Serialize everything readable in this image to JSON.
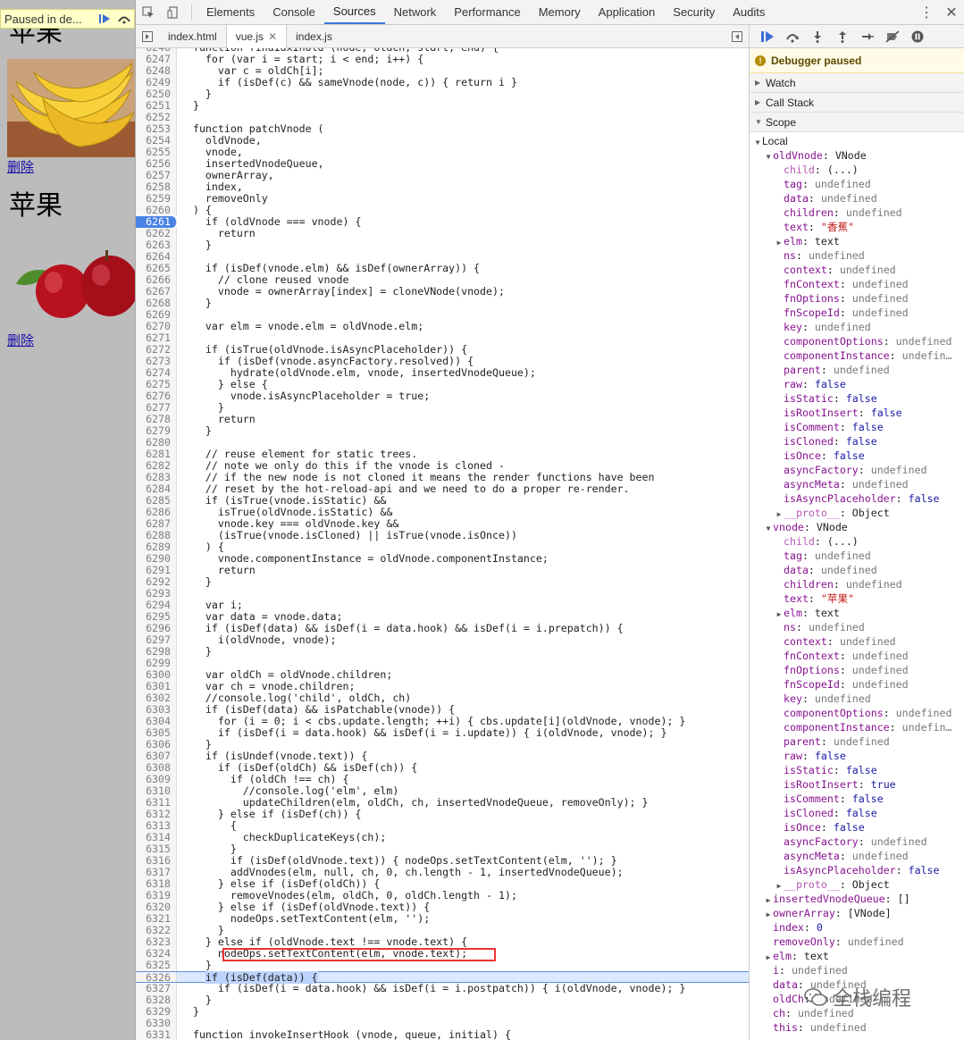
{
  "preview": {
    "paused_text": "Paused in de...",
    "items": [
      {
        "title": "苹果",
        "delete": "删除"
      },
      {
        "title": "苹果",
        "delete": "删除"
      }
    ]
  },
  "devtools": {
    "tabs": [
      "Elements",
      "Console",
      "Sources",
      "Network",
      "Performance",
      "Memory",
      "Application",
      "Security",
      "Audits"
    ],
    "active_tab": "Sources",
    "file_tabs": [
      {
        "name": "index.html",
        "active": false,
        "closable": false
      },
      {
        "name": "vue.js",
        "active": true,
        "closable": true
      },
      {
        "name": "index.js",
        "active": false,
        "closable": false
      }
    ],
    "breakpoint_line": 6261,
    "paused_line": 6326,
    "highlighted_line": 6324,
    "code_lines": [
      {
        "n": 6246,
        "t": "  function findIdxInOld (node, oldCh, start, end) {"
      },
      {
        "n": 6247,
        "t": "    for (var i = start; i < end; i++) {"
      },
      {
        "n": 6248,
        "t": "      var c = oldCh[i];"
      },
      {
        "n": 6249,
        "t": "      if (isDef(c) && sameVnode(node, c)) { return i }"
      },
      {
        "n": 6250,
        "t": "    }"
      },
      {
        "n": 6251,
        "t": "  }"
      },
      {
        "n": 6252,
        "t": ""
      },
      {
        "n": 6253,
        "t": "  function patchVnode ("
      },
      {
        "n": 6254,
        "t": "    oldVnode,"
      },
      {
        "n": 6255,
        "t": "    vnode,"
      },
      {
        "n": 6256,
        "t": "    insertedVnodeQueue,"
      },
      {
        "n": 6257,
        "t": "    ownerArray,"
      },
      {
        "n": 6258,
        "t": "    index,"
      },
      {
        "n": 6259,
        "t": "    removeOnly"
      },
      {
        "n": 6260,
        "t": "  ) {"
      },
      {
        "n": 6261,
        "t": "    if (oldVnode === vnode) {"
      },
      {
        "n": 6262,
        "t": "      return"
      },
      {
        "n": 6263,
        "t": "    }"
      },
      {
        "n": 6264,
        "t": ""
      },
      {
        "n": 6265,
        "t": "    if (isDef(vnode.elm) && isDef(ownerArray)) {"
      },
      {
        "n": 6266,
        "t": "      // clone reused vnode"
      },
      {
        "n": 6267,
        "t": "      vnode = ownerArray[index] = cloneVNode(vnode);"
      },
      {
        "n": 6268,
        "t": "    }"
      },
      {
        "n": 6269,
        "t": ""
      },
      {
        "n": 6270,
        "t": "    var elm = vnode.elm = oldVnode.elm;"
      },
      {
        "n": 6271,
        "t": ""
      },
      {
        "n": 6272,
        "t": "    if (isTrue(oldVnode.isAsyncPlaceholder)) {"
      },
      {
        "n": 6273,
        "t": "      if (isDef(vnode.asyncFactory.resolved)) {"
      },
      {
        "n": 6274,
        "t": "        hydrate(oldVnode.elm, vnode, insertedVnodeQueue);"
      },
      {
        "n": 6275,
        "t": "      } else {"
      },
      {
        "n": 6276,
        "t": "        vnode.isAsyncPlaceholder = true;"
      },
      {
        "n": 6277,
        "t": "      }"
      },
      {
        "n": 6278,
        "t": "      return"
      },
      {
        "n": 6279,
        "t": "    }"
      },
      {
        "n": 6280,
        "t": ""
      },
      {
        "n": 6281,
        "t": "    // reuse element for static trees."
      },
      {
        "n": 6282,
        "t": "    // note we only do this if the vnode is cloned -"
      },
      {
        "n": 6283,
        "t": "    // if the new node is not cloned it means the render functions have been"
      },
      {
        "n": 6284,
        "t": "    // reset by the hot-reload-api and we need to do a proper re-render."
      },
      {
        "n": 6285,
        "t": "    if (isTrue(vnode.isStatic) &&"
      },
      {
        "n": 6286,
        "t": "      isTrue(oldVnode.isStatic) &&"
      },
      {
        "n": 6287,
        "t": "      vnode.key === oldVnode.key &&"
      },
      {
        "n": 6288,
        "t": "      (isTrue(vnode.isCloned) || isTrue(vnode.isOnce))"
      },
      {
        "n": 6289,
        "t": "    ) {"
      },
      {
        "n": 6290,
        "t": "      vnode.componentInstance = oldVnode.componentInstance;"
      },
      {
        "n": 6291,
        "t": "      return"
      },
      {
        "n": 6292,
        "t": "    }"
      },
      {
        "n": 6293,
        "t": ""
      },
      {
        "n": 6294,
        "t": "    var i;"
      },
      {
        "n": 6295,
        "t": "    var data = vnode.data;"
      },
      {
        "n": 6296,
        "t": "    if (isDef(data) && isDef(i = data.hook) && isDef(i = i.prepatch)) {"
      },
      {
        "n": 6297,
        "t": "      i(oldVnode, vnode);"
      },
      {
        "n": 6298,
        "t": "    }"
      },
      {
        "n": 6299,
        "t": ""
      },
      {
        "n": 6300,
        "t": "    var oldCh = oldVnode.children;"
      },
      {
        "n": 6301,
        "t": "    var ch = vnode.children;"
      },
      {
        "n": 6302,
        "t": "    //console.log('child', oldCh, ch)"
      },
      {
        "n": 6303,
        "t": "    if (isDef(data) && isPatchable(vnode)) {"
      },
      {
        "n": 6304,
        "t": "      for (i = 0; i < cbs.update.length; ++i) { cbs.update[i](oldVnode, vnode); }"
      },
      {
        "n": 6305,
        "t": "      if (isDef(i = data.hook) && isDef(i = i.update)) { i(oldVnode, vnode); }"
      },
      {
        "n": 6306,
        "t": "    }"
      },
      {
        "n": 6307,
        "t": "    if (isUndef(vnode.text)) {"
      },
      {
        "n": 6308,
        "t": "      if (isDef(oldCh) && isDef(ch)) {"
      },
      {
        "n": 6309,
        "t": "        if (oldCh !== ch) {"
      },
      {
        "n": 6310,
        "t": "          //console.log('elm', elm)"
      },
      {
        "n": 6311,
        "t": "          updateChildren(elm, oldCh, ch, insertedVnodeQueue, removeOnly); }"
      },
      {
        "n": 6312,
        "t": "      } else if (isDef(ch)) {"
      },
      {
        "n": 6313,
        "t": "        {"
      },
      {
        "n": 6314,
        "t": "          checkDuplicateKeys(ch);"
      },
      {
        "n": 6315,
        "t": "        }"
      },
      {
        "n": 6316,
        "t": "        if (isDef(oldVnode.text)) { nodeOps.setTextContent(elm, ''); }"
      },
      {
        "n": 6317,
        "t": "        addVnodes(elm, null, ch, 0, ch.length - 1, insertedVnodeQueue);"
      },
      {
        "n": 6318,
        "t": "      } else if (isDef(oldCh)) {"
      },
      {
        "n": 6319,
        "t": "        removeVnodes(elm, oldCh, 0, oldCh.length - 1);"
      },
      {
        "n": 6320,
        "t": "      } else if (isDef(oldVnode.text)) {"
      },
      {
        "n": 6321,
        "t": "        nodeOps.setTextContent(elm, '');"
      },
      {
        "n": 6322,
        "t": "      }"
      },
      {
        "n": 6323,
        "t": "    } else if (oldVnode.text !== vnode.text) {"
      },
      {
        "n": 6324,
        "t": "      nodeOps.setTextContent(elm, vnode.text);"
      },
      {
        "n": 6325,
        "t": "    }"
      },
      {
        "n": 6326,
        "t": "    if (isDef(data)) {"
      },
      {
        "n": 6327,
        "t": "      if (isDef(i = data.hook) && isDef(i = i.postpatch)) { i(oldVnode, vnode); }"
      },
      {
        "n": 6328,
        "t": "    }"
      },
      {
        "n": 6329,
        "t": "  }"
      },
      {
        "n": 6330,
        "t": ""
      },
      {
        "n": 6331,
        "t": "  function invokeInsertHook (vnode, queue, initial) {"
      }
    ],
    "debugger": {
      "paused_label": "Debugger paused",
      "sections": [
        "Watch",
        "Call Stack",
        "Scope"
      ],
      "local_label": "Local",
      "scope": [
        {
          "d": 1,
          "tw": "▼",
          "k": "oldVnode",
          "v": "VNode",
          "vt": "obj"
        },
        {
          "d": 2,
          "tw": "",
          "k": "child",
          "v": "(...)",
          "vt": "obj",
          "dim": true
        },
        {
          "d": 2,
          "tw": "",
          "k": "tag",
          "v": "undefined",
          "vt": "undef"
        },
        {
          "d": 2,
          "tw": "",
          "k": "data",
          "v": "undefined",
          "vt": "undef"
        },
        {
          "d": 2,
          "tw": "",
          "k": "children",
          "v": "undefined",
          "vt": "undef"
        },
        {
          "d": 2,
          "tw": "",
          "k": "text",
          "v": "\"香蕉\"",
          "vt": "str"
        },
        {
          "d": 2,
          "tw": "▶",
          "k": "elm",
          "v": "text",
          "vt": "obj"
        },
        {
          "d": 2,
          "tw": "",
          "k": "ns",
          "v": "undefined",
          "vt": "undef"
        },
        {
          "d": 2,
          "tw": "",
          "k": "context",
          "v": "undefined",
          "vt": "undef"
        },
        {
          "d": 2,
          "tw": "",
          "k": "fnContext",
          "v": "undefined",
          "vt": "undef"
        },
        {
          "d": 2,
          "tw": "",
          "k": "fnOptions",
          "v": "undefined",
          "vt": "undef"
        },
        {
          "d": 2,
          "tw": "",
          "k": "fnScopeId",
          "v": "undefined",
          "vt": "undef"
        },
        {
          "d": 2,
          "tw": "",
          "k": "key",
          "v": "undefined",
          "vt": "undef"
        },
        {
          "d": 2,
          "tw": "",
          "k": "componentOptions",
          "v": "undefined",
          "vt": "undef"
        },
        {
          "d": 2,
          "tw": "",
          "k": "componentInstance",
          "v": "undefin…",
          "vt": "undef"
        },
        {
          "d": 2,
          "tw": "",
          "k": "parent",
          "v": "undefined",
          "vt": "undef"
        },
        {
          "d": 2,
          "tw": "",
          "k": "raw",
          "v": "false",
          "vt": "bool"
        },
        {
          "d": 2,
          "tw": "",
          "k": "isStatic",
          "v": "false",
          "vt": "bool"
        },
        {
          "d": 2,
          "tw": "",
          "k": "isRootInsert",
          "v": "false",
          "vt": "bool"
        },
        {
          "d": 2,
          "tw": "",
          "k": "isComment",
          "v": "false",
          "vt": "bool"
        },
        {
          "d": 2,
          "tw": "",
          "k": "isCloned",
          "v": "false",
          "vt": "bool"
        },
        {
          "d": 2,
          "tw": "",
          "k": "isOnce",
          "v": "false",
          "vt": "bool"
        },
        {
          "d": 2,
          "tw": "",
          "k": "asyncFactory",
          "v": "undefined",
          "vt": "undef"
        },
        {
          "d": 2,
          "tw": "",
          "k": "asyncMeta",
          "v": "undefined",
          "vt": "undef"
        },
        {
          "d": 2,
          "tw": "",
          "k": "isAsyncPlaceholder",
          "v": "false",
          "vt": "bool"
        },
        {
          "d": 2,
          "tw": "▶",
          "k": "__proto__",
          "v": "Object",
          "vt": "obj",
          "dim": true
        },
        {
          "d": 1,
          "tw": "▼",
          "k": "vnode",
          "v": "VNode",
          "vt": "obj"
        },
        {
          "d": 2,
          "tw": "",
          "k": "child",
          "v": "(...)",
          "vt": "obj",
          "dim": true
        },
        {
          "d": 2,
          "tw": "",
          "k": "tag",
          "v": "undefined",
          "vt": "undef"
        },
        {
          "d": 2,
          "tw": "",
          "k": "data",
          "v": "undefined",
          "vt": "undef"
        },
        {
          "d": 2,
          "tw": "",
          "k": "children",
          "v": "undefined",
          "vt": "undef"
        },
        {
          "d": 2,
          "tw": "",
          "k": "text",
          "v": "\"苹果\"",
          "vt": "str"
        },
        {
          "d": 2,
          "tw": "▶",
          "k": "elm",
          "v": "text",
          "vt": "obj"
        },
        {
          "d": 2,
          "tw": "",
          "k": "ns",
          "v": "undefined",
          "vt": "undef"
        },
        {
          "d": 2,
          "tw": "",
          "k": "context",
          "v": "undefined",
          "vt": "undef"
        },
        {
          "d": 2,
          "tw": "",
          "k": "fnContext",
          "v": "undefined",
          "vt": "undef"
        },
        {
          "d": 2,
          "tw": "",
          "k": "fnOptions",
          "v": "undefined",
          "vt": "undef"
        },
        {
          "d": 2,
          "tw": "",
          "k": "fnScopeId",
          "v": "undefined",
          "vt": "undef"
        },
        {
          "d": 2,
          "tw": "",
          "k": "key",
          "v": "undefined",
          "vt": "undef"
        },
        {
          "d": 2,
          "tw": "",
          "k": "componentOptions",
          "v": "undefined",
          "vt": "undef"
        },
        {
          "d": 2,
          "tw": "",
          "k": "componentInstance",
          "v": "undefin…",
          "vt": "undef"
        },
        {
          "d": 2,
          "tw": "",
          "k": "parent",
          "v": "undefined",
          "vt": "undef"
        },
        {
          "d": 2,
          "tw": "",
          "k": "raw",
          "v": "false",
          "vt": "bool"
        },
        {
          "d": 2,
          "tw": "",
          "k": "isStatic",
          "v": "false",
          "vt": "bool"
        },
        {
          "d": 2,
          "tw": "",
          "k": "isRootInsert",
          "v": "true",
          "vt": "bool"
        },
        {
          "d": 2,
          "tw": "",
          "k": "isComment",
          "v": "false",
          "vt": "bool"
        },
        {
          "d": 2,
          "tw": "",
          "k": "isCloned",
          "v": "false",
          "vt": "bool"
        },
        {
          "d": 2,
          "tw": "",
          "k": "isOnce",
          "v": "false",
          "vt": "bool"
        },
        {
          "d": 2,
          "tw": "",
          "k": "asyncFactory",
          "v": "undefined",
          "vt": "undef"
        },
        {
          "d": 2,
          "tw": "",
          "k": "asyncMeta",
          "v": "undefined",
          "vt": "undef"
        },
        {
          "d": 2,
          "tw": "",
          "k": "isAsyncPlaceholder",
          "v": "false",
          "vt": "bool"
        },
        {
          "d": 2,
          "tw": "▶",
          "k": "__proto__",
          "v": "Object",
          "vt": "obj",
          "dim": true
        },
        {
          "d": 1,
          "tw": "▶",
          "k": "insertedVnodeQueue",
          "v": "[]",
          "vt": "obj"
        },
        {
          "d": 1,
          "tw": "▶",
          "k": "ownerArray",
          "v": "[VNode]",
          "vt": "obj"
        },
        {
          "d": 1,
          "tw": "",
          "k": "index",
          "v": "0",
          "vt": "num"
        },
        {
          "d": 1,
          "tw": "",
          "k": "removeOnly",
          "v": "undefined",
          "vt": "undef"
        },
        {
          "d": 1,
          "tw": "▶",
          "k": "elm",
          "v": "text",
          "vt": "obj"
        },
        {
          "d": 1,
          "tw": "",
          "k": "i",
          "v": "undefined",
          "vt": "undef"
        },
        {
          "d": 1,
          "tw": "",
          "k": "data",
          "v": "undefined",
          "vt": "undef"
        },
        {
          "d": 1,
          "tw": "",
          "k": "oldCh",
          "v": "undefined",
          "vt": "undef"
        },
        {
          "d": 1,
          "tw": "",
          "k": "ch",
          "v": "undefined",
          "vt": "undef"
        },
        {
          "d": 1,
          "tw": "",
          "k": "this",
          "v": "undefined",
          "vt": "undef"
        }
      ]
    }
  },
  "watermark": "全栈编程"
}
